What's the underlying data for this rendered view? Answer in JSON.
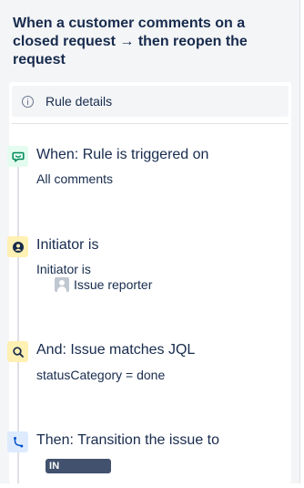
{
  "rule": {
    "title": "When a customer comments on a closed request → then reopen the request"
  },
  "details": {
    "label": "Rule details",
    "icon": "info-icon"
  },
  "steps": [
    {
      "icon": "comment-icon",
      "icon_color": "#e3fcef",
      "heading": "When: Rule is triggered on",
      "detail": "All comments"
    },
    {
      "icon": "user-icon",
      "icon_color": "#fff0b3",
      "heading": "Initiator is",
      "detail": "Initiator is",
      "value": "Issue reporter",
      "value_icon": "avatar-icon"
    },
    {
      "icon": "search-icon",
      "icon_color": "#fff0b3",
      "heading": "And: Issue matches JQL",
      "detail": "statusCategory = done"
    },
    {
      "icon": "branch-icon",
      "icon_color": "#deebff",
      "heading": "Then: Transition the issue to",
      "status": "IN PROGRESS",
      "status_color": "#42526e"
    }
  ]
}
